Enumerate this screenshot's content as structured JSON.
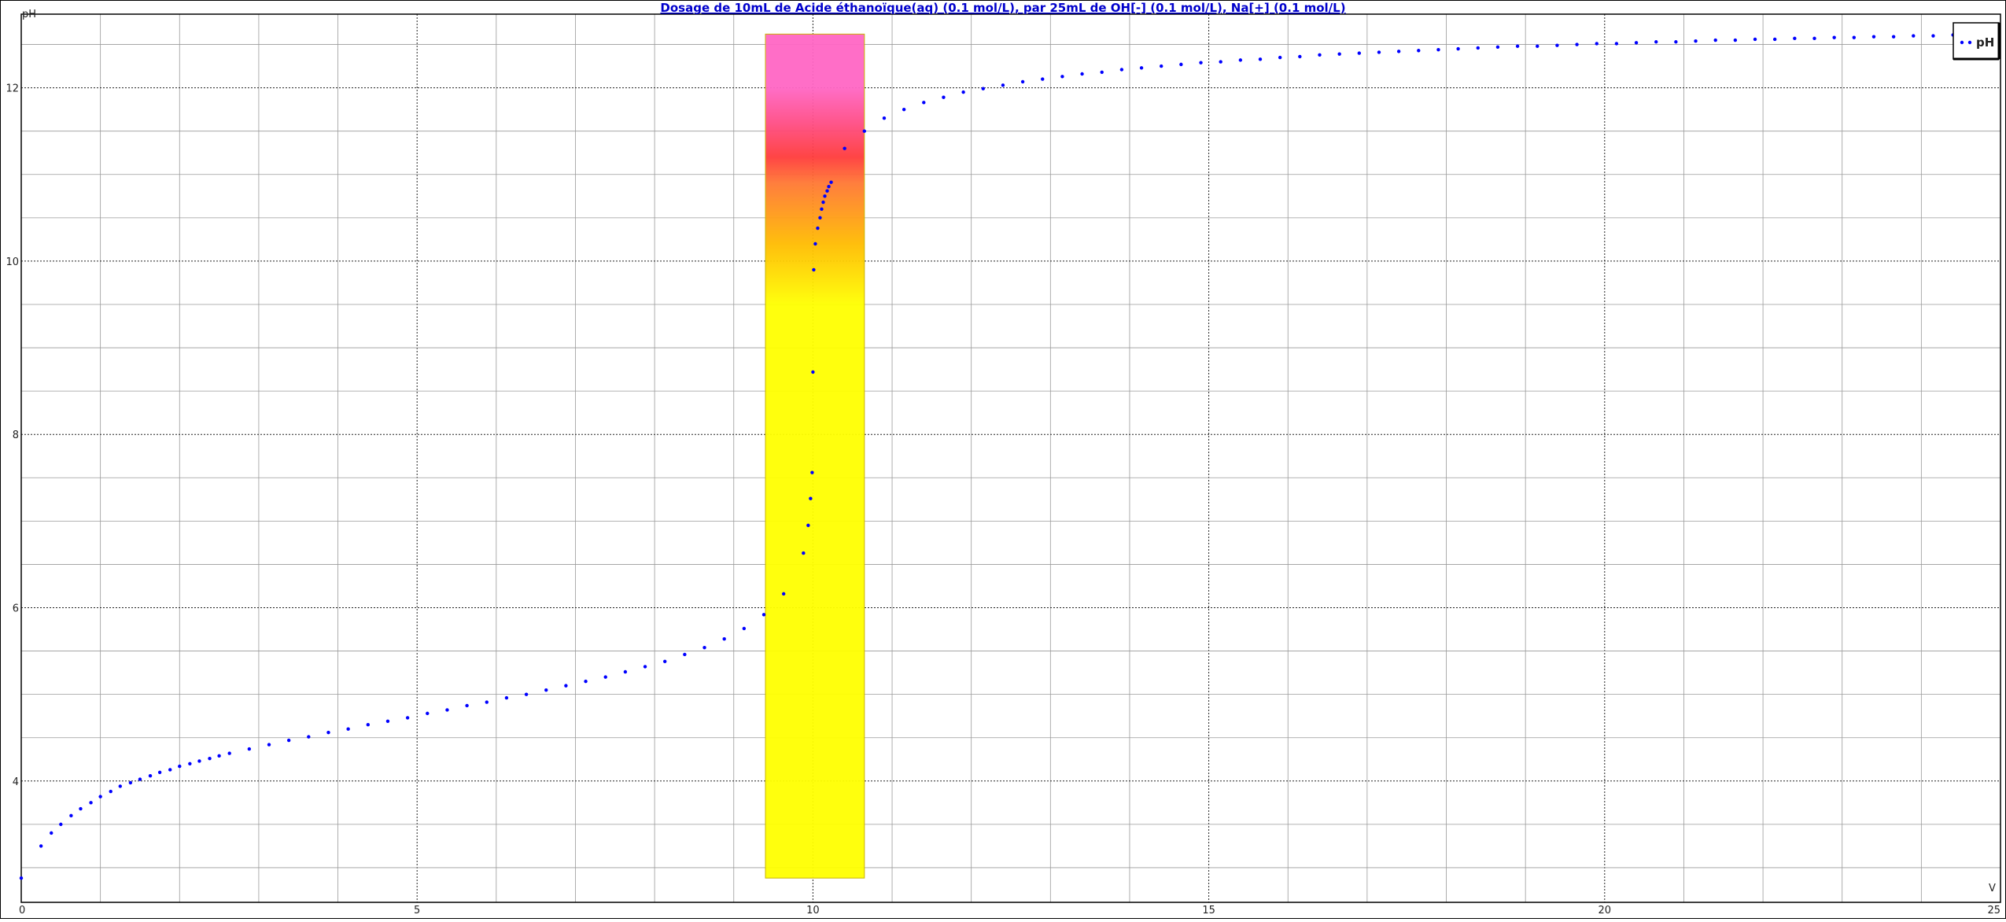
{
  "chart_data": {
    "type": "scatter",
    "title": "Dosage de 10mL de Acide éthanoïque(aq) (0.1 mol/L),  par 25mL  de OH[-] (0.1 mol/L), Na[+] (0.1 mol/L)",
    "xlabel": "V",
    "ylabel": "pH",
    "xlim": [
      0,
      25
    ],
    "ylim": [
      2.6,
      12.85
    ],
    "x_ticks": [
      0,
      5,
      10,
      15,
      20,
      25
    ],
    "y_ticks": [
      4,
      6,
      8,
      10,
      12
    ],
    "grid": true,
    "legend": {
      "position": "top-right",
      "entries": [
        "pH"
      ]
    },
    "indicator_band": {
      "x_range": [
        9.4,
        10.65
      ],
      "y_range": [
        2.88,
        12.62
      ],
      "color_stops": [
        {
          "ph": 2.88,
          "color": "#ffff00"
        },
        {
          "ph": 9.5,
          "color": "#ffff00"
        },
        {
          "ph": 10.2,
          "color": "#ffbb00"
        },
        {
          "ph": 10.9,
          "color": "#ff7733"
        },
        {
          "ph": 11.2,
          "color": "#ff3b3b"
        },
        {
          "ph": 11.6,
          "color": "#ff4d86"
        },
        {
          "ph": 12.0,
          "color": "#ff66c4"
        },
        {
          "ph": 12.62,
          "color": "#ff66c4"
        }
      ]
    },
    "series": [
      {
        "name": "pH",
        "color": "#0000ff",
        "points": [
          [
            0.0,
            2.88
          ],
          [
            0.25,
            3.25
          ],
          [
            0.38,
            3.4
          ],
          [
            0.5,
            3.5
          ],
          [
            0.63,
            3.6
          ],
          [
            0.75,
            3.68
          ],
          [
            0.88,
            3.75
          ],
          [
            1.0,
            3.82
          ],
          [
            1.13,
            3.88
          ],
          [
            1.25,
            3.94
          ],
          [
            1.38,
            3.98
          ],
          [
            1.5,
            4.02
          ],
          [
            1.63,
            4.06
          ],
          [
            1.75,
            4.1
          ],
          [
            1.88,
            4.13
          ],
          [
            2.0,
            4.17
          ],
          [
            2.13,
            4.2
          ],
          [
            2.25,
            4.23
          ],
          [
            2.38,
            4.26
          ],
          [
            2.5,
            4.29
          ],
          [
            2.63,
            4.32
          ],
          [
            2.88,
            4.37
          ],
          [
            3.13,
            4.42
          ],
          [
            3.38,
            4.47
          ],
          [
            3.63,
            4.51
          ],
          [
            3.88,
            4.56
          ],
          [
            4.13,
            4.6
          ],
          [
            4.38,
            4.65
          ],
          [
            4.63,
            4.69
          ],
          [
            4.88,
            4.73
          ],
          [
            5.13,
            4.78
          ],
          [
            5.38,
            4.82
          ],
          [
            5.63,
            4.87
          ],
          [
            5.88,
            4.91
          ],
          [
            6.13,
            4.96
          ],
          [
            6.38,
            5.0
          ],
          [
            6.63,
            5.05
          ],
          [
            6.88,
            5.1
          ],
          [
            7.13,
            5.15
          ],
          [
            7.38,
            5.2
          ],
          [
            7.63,
            5.26
          ],
          [
            7.88,
            5.32
          ],
          [
            8.13,
            5.38
          ],
          [
            8.38,
            5.46
          ],
          [
            8.63,
            5.54
          ],
          [
            8.88,
            5.64
          ],
          [
            9.13,
            5.76
          ],
          [
            9.38,
            5.92
          ],
          [
            9.63,
            6.16
          ],
          [
            9.88,
            6.63
          ],
          [
            9.94,
            6.95
          ],
          [
            9.97,
            7.26
          ],
          [
            9.99,
            7.56
          ],
          [
            10.0,
            8.72
          ],
          [
            10.01,
            9.9
          ],
          [
            10.03,
            10.2
          ],
          [
            10.06,
            10.38
          ],
          [
            10.09,
            10.5
          ],
          [
            10.11,
            10.6
          ],
          [
            10.13,
            10.68
          ],
          [
            10.15,
            10.75
          ],
          [
            10.18,
            10.81
          ],
          [
            10.2,
            10.86
          ],
          [
            10.23,
            10.91
          ],
          [
            10.4,
            11.3
          ],
          [
            10.65,
            11.5
          ],
          [
            10.9,
            11.65
          ],
          [
            11.15,
            11.75
          ],
          [
            11.4,
            11.83
          ],
          [
            11.65,
            11.89
          ],
          [
            11.9,
            11.95
          ],
          [
            12.15,
            11.99
          ],
          [
            12.4,
            12.03
          ],
          [
            12.65,
            12.07
          ],
          [
            12.9,
            12.1
          ],
          [
            13.15,
            12.13
          ],
          [
            13.4,
            12.16
          ],
          [
            13.65,
            12.18
          ],
          [
            13.9,
            12.21
          ],
          [
            14.15,
            12.23
          ],
          [
            14.4,
            12.25
          ],
          [
            14.65,
            12.27
          ],
          [
            14.9,
            12.29
          ],
          [
            15.15,
            12.3
          ],
          [
            15.4,
            12.32
          ],
          [
            15.65,
            12.33
          ],
          [
            15.9,
            12.35
          ],
          [
            16.15,
            12.36
          ],
          [
            16.4,
            12.38
          ],
          [
            16.65,
            12.39
          ],
          [
            16.9,
            12.4
          ],
          [
            17.15,
            12.41
          ],
          [
            17.4,
            12.42
          ],
          [
            17.65,
            12.43
          ],
          [
            17.9,
            12.44
          ],
          [
            18.15,
            12.45
          ],
          [
            18.4,
            12.46
          ],
          [
            18.65,
            12.47
          ],
          [
            18.9,
            12.48
          ],
          [
            19.15,
            12.48
          ],
          [
            19.4,
            12.49
          ],
          [
            19.65,
            12.5
          ],
          [
            19.9,
            12.51
          ],
          [
            20.15,
            12.51
          ],
          [
            20.4,
            12.52
          ],
          [
            20.65,
            12.53
          ],
          [
            20.9,
            12.53
          ],
          [
            21.15,
            12.54
          ],
          [
            21.4,
            12.55
          ],
          [
            21.65,
            12.55
          ],
          [
            21.9,
            12.56
          ],
          [
            22.15,
            12.56
          ],
          [
            22.4,
            12.57
          ],
          [
            22.65,
            12.57
          ],
          [
            22.9,
            12.58
          ],
          [
            23.15,
            12.58
          ],
          [
            23.4,
            12.59
          ],
          [
            23.65,
            12.59
          ],
          [
            23.9,
            12.6
          ],
          [
            24.15,
            12.6
          ],
          [
            24.4,
            12.61
          ]
        ]
      }
    ]
  }
}
